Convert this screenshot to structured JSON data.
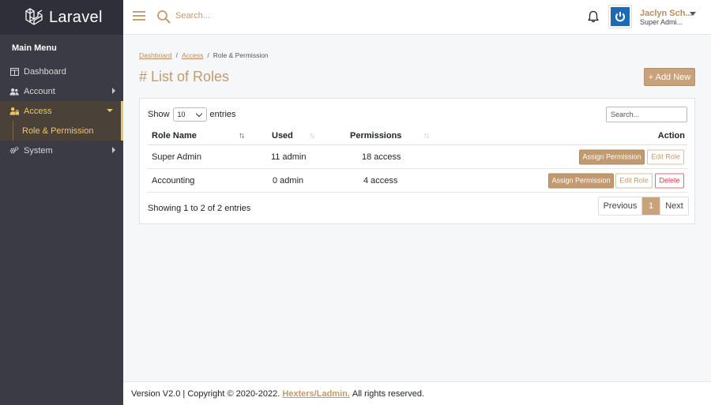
{
  "brand": {
    "name": "Laravel"
  },
  "sidebar": {
    "title": "Main Menu",
    "items": [
      {
        "label": "Dashboard",
        "icon": "columns-icon"
      },
      {
        "label": "Account",
        "icon": "users-icon"
      },
      {
        "label": "Access",
        "icon": "user-lock-icon"
      },
      {
        "label": "System",
        "icon": "cogs-icon"
      }
    ],
    "submenu": {
      "label": "Role & Permission"
    }
  },
  "topbar": {
    "search_placeholder": "Search...",
    "user_name": "Jaclyn Sch...",
    "user_role": "Super Admi..."
  },
  "breadcrumb": [
    "Dashboard",
    "Access",
    "Role & Permission"
  ],
  "page": {
    "title": "# List of Roles",
    "add_label": "+ Add New"
  },
  "table": {
    "show_label": "Show",
    "length_value": "10",
    "entries_label": "entries",
    "search_placeholder": "Search...",
    "columns": [
      "Role Name",
      "Used",
      "Permissions",
      "Action"
    ],
    "rows": [
      {
        "name": "Super Admin",
        "used": "11 admin",
        "permissions": "18 access",
        "actions": [
          "Assign Permission",
          "Edit Role"
        ]
      },
      {
        "name": "Accounting",
        "used": "0 admin",
        "permissions": "4 access",
        "actions": [
          "Assign Permission",
          "Edit Role",
          "Delete"
        ]
      }
    ],
    "info": "Showing 1 to 2 of 2 entries",
    "pagination": {
      "prev": "Previous",
      "current": "1",
      "next": "Next"
    }
  },
  "footer": {
    "prefix": "Version V2.0 | Copyright © 2020-2022.",
    "link": "Hexters/Ladmin.",
    "suffix": "All rights reserved."
  },
  "colors": {
    "accent": "#c29a70",
    "sidebar_bg": "#3a3b45",
    "active_text": "#f0c466",
    "danger": "#dc3545"
  }
}
